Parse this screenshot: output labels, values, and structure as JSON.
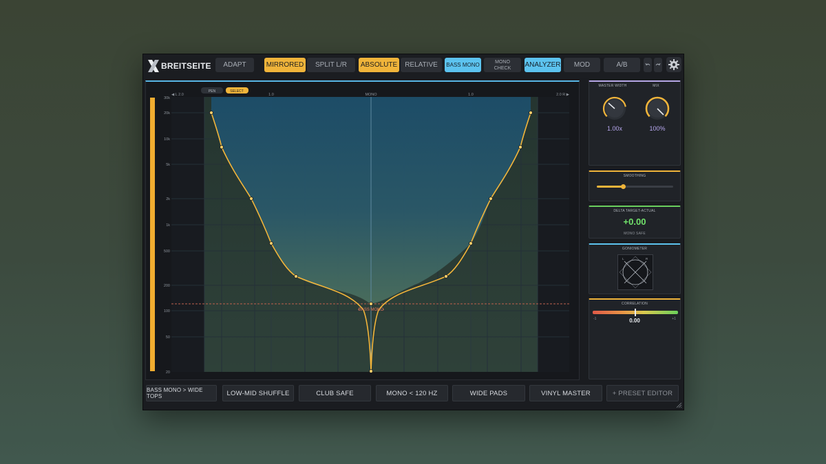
{
  "app": {
    "logo_mark": "X",
    "logo_text": "BREITSEITE"
  },
  "toolbar": {
    "adapt": "ADAPT",
    "mirrored": "MIRRORED",
    "split": "SPLIT L/R",
    "absolute": "ABSOLUTE",
    "relative": "RELATIVE",
    "bass_mono": "BASS MONO",
    "mono_check_line1": "MONO",
    "mono_check_line2": "CHECK",
    "analyzer": "ANALYZER",
    "mod": "MOD",
    "ab": "A/B",
    "undo_icon": "undo-icon",
    "redo_icon": "redo-icon",
    "settings_icon": "gear-icon"
  },
  "plot": {
    "tool_pen": "PEN",
    "tool_select": "SELECT",
    "x_left": "◀ L 2.0",
    "x_right": "2.0 R ▶",
    "x_ticks": [
      "1.0",
      "MONO",
      "1.0"
    ],
    "y_ticks": [
      "30k",
      "20k",
      "10k",
      "5k",
      "2k",
      "1k",
      "500",
      "200",
      "100",
      "50",
      "20"
    ],
    "bass_mono_marker": "BASS MONO",
    "curve_points_hz": [
      {
        "width": 1.95,
        "hz": 20000
      },
      {
        "width": 1.75,
        "hz": 8000
      },
      {
        "width": 1.2,
        "hz": 2000
      },
      {
        "width": 1.0,
        "hz": 600
      },
      {
        "width": 0.75,
        "hz": 240
      },
      {
        "width": 0.0,
        "hz": 120
      },
      {
        "width": 0.0,
        "hz": 20
      }
    ],
    "colors": {
      "curve": "#f3b53a",
      "fill_top": "#1c4f6d",
      "fill_bottom": "#4c7160",
      "marker": "#e87a5d"
    }
  },
  "panels": {
    "master_width": {
      "title": "MASTER WIDTH",
      "value": "1.00x"
    },
    "mix": {
      "title": "MIX",
      "value": "100%"
    },
    "smoothing": {
      "title": "SMOOTHING",
      "level": 0.35
    },
    "delta": {
      "title": "DELTA TARGET-ACTUAL",
      "value": "+0.00",
      "status": "MONO SAFE"
    },
    "goniometer": {
      "title": "GONIOMETER",
      "l": "L",
      "r": "R"
    },
    "correlation": {
      "title": "CORRELATION",
      "min": "-1",
      "max": "+1",
      "value": "0.00"
    }
  },
  "presets": [
    "BASS MONO > WIDE TOPS",
    "LOW-MID SHUFFLE",
    "CLUB SAFE",
    "MONO < 120 HZ",
    "WIDE PADS",
    "VINYL MASTER",
    "+ PRESET EDITOR"
  ]
}
